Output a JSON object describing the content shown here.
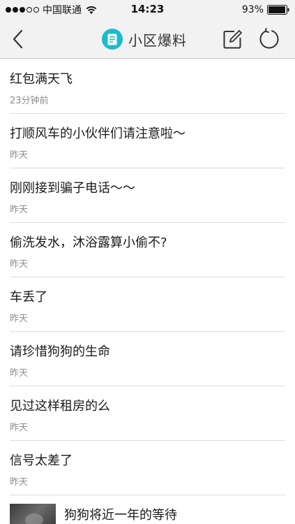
{
  "status_bar": {
    "carrier": "中国联通",
    "time": "14:23",
    "battery": "93%"
  },
  "nav": {
    "title": "小区爆料",
    "accent_color": "#1bbcd0",
    "icons": [
      "back-arrow-icon",
      "document-icon",
      "compose-icon",
      "refresh-icon"
    ]
  },
  "items": [
    {
      "title": "红包满天飞",
      "time": "23分钟前"
    },
    {
      "title": "打顺风车的小伙伴们请注意啦～",
      "time": "昨天"
    },
    {
      "title": "刚刚接到骗子电话～～",
      "time": "昨天"
    },
    {
      "title": "偷洗发水，沐浴露算小偷不?",
      "time": "昨天"
    },
    {
      "title": "车丢了",
      "time": "昨天"
    },
    {
      "title": "请珍惜狗狗的生命",
      "time": "昨天"
    },
    {
      "title": "见过这样租房的么",
      "time": "昨天"
    },
    {
      "title": "信号太差了",
      "time": "昨天"
    }
  ],
  "media_item": {
    "title": "狗狗将近一年的等待"
  }
}
